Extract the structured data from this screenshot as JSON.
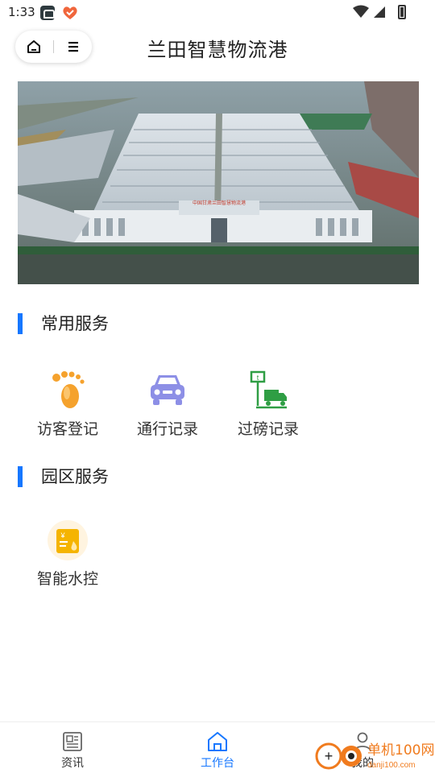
{
  "status_bar": {
    "time": "1:33"
  },
  "header": {
    "title": "兰田智慧物流港"
  },
  "sections": [
    {
      "title": "常用服务",
      "items": [
        {
          "label": "访客登记",
          "icon": "footprint-icon"
        },
        {
          "label": "通行记录",
          "icon": "car-icon"
        },
        {
          "label": "过磅记录",
          "icon": "truck-scale-icon"
        }
      ]
    },
    {
      "title": "园区服务",
      "items": [
        {
          "label": "智能水控",
          "icon": "water-bill-icon"
        }
      ]
    }
  ],
  "tabbar": {
    "items": [
      {
        "label": "资讯",
        "icon": "news-icon",
        "active": false
      },
      {
        "label": "工作台",
        "icon": "home-icon",
        "active": true
      },
      {
        "label": "我的",
        "icon": "user-icon",
        "active": false
      }
    ]
  },
  "banner": {
    "sign_text": "中国甘肃兰田智慧物流港"
  },
  "watermark": {
    "text": "单机100网",
    "url_text": "danji100.com"
  },
  "colors": {
    "accent": "#1677ff",
    "footprint": "#f5a22d",
    "car": "#8d8fe6",
    "scale": "#2f9e44",
    "water": "#f5b400"
  }
}
